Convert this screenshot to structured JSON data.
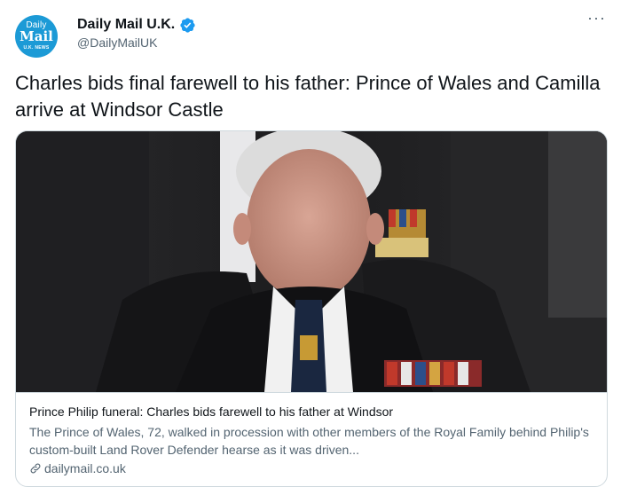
{
  "account": {
    "avatar_line1": "Daily",
    "avatar_line2": "Mail",
    "avatar_line3": "U.K. NEWS",
    "display_name": "Daily Mail U.K.",
    "handle": "@DailyMailUK",
    "verified": true
  },
  "more_label": "···",
  "tweet": {
    "text": "Charles bids final farewell to his father: Prince of Wales and Camilla arrive at Windsor Castle"
  },
  "card": {
    "title": "Prince Philip funeral: Charles bids farewell to his father at Windsor",
    "description": "The Prince of Wales, 72, walked in procession with other members of the Royal Family behind Philip's custom-built Land Rover Defender hearse as it was driven...",
    "domain": "dailymail.co.uk"
  },
  "colors": {
    "brand_blue": "#1c9ad6",
    "verified_blue": "#1d9bf0",
    "text_primary": "#0f1419",
    "text_secondary": "#536471",
    "border": "#cfd9de"
  },
  "icons": {
    "verified": "verified-badge-icon",
    "more": "more-options-icon",
    "link": "link-icon"
  }
}
